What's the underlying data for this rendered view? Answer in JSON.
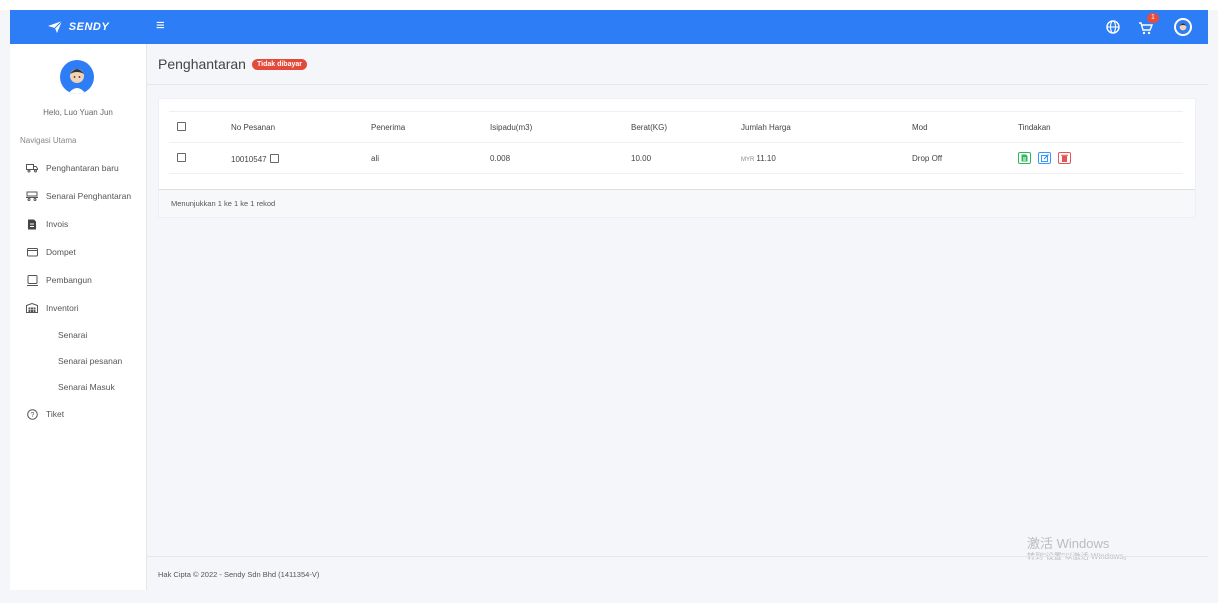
{
  "app": {
    "brand": "SENDY",
    "cart_count": "1",
    "accent_color": "#2d7df6"
  },
  "sidebar": {
    "greeting": "Helo, Luo Yuan Jun",
    "nav_heading": "Navigasi Utama",
    "items": [
      {
        "label": "Penghantaran baru",
        "icon": "truck-icon"
      },
      {
        "label": "Senarai Penghantaran",
        "icon": "list-truck-icon"
      },
      {
        "label": "Invois",
        "icon": "invoice-icon"
      },
      {
        "label": "Dompet",
        "icon": "wallet-icon"
      },
      {
        "label": "Pembangun",
        "icon": "developer-icon"
      },
      {
        "label": "Inventori",
        "icon": "warehouse-icon"
      }
    ],
    "sub_items": [
      "Senarai",
      "Senarai pesanan",
      "Senarai Masuk"
    ],
    "ticket": {
      "label": "Tiket",
      "icon": "help-icon"
    }
  },
  "page": {
    "title": "Penghantaran",
    "status_badge": "Tidak dibayar"
  },
  "table": {
    "headers": [
      "No Pesanan",
      "Penerima",
      "Isipadu(m3)",
      "Berat(KG)",
      "Jumlah Harga",
      "Mod",
      "Tindakan"
    ],
    "rows": [
      {
        "order_no": "10010547",
        "recipient": "ali",
        "volume": "0.008",
        "weight": "10.00",
        "currency": "MYR",
        "price": "11.10",
        "mode": "Drop Off"
      }
    ],
    "footer": "Menunjukkan 1 ke 1 ke 1 rekod"
  },
  "footer": {
    "copyright": "Hak Cipta © 2022 - Sendy Sdn Bhd (1411354-V)"
  },
  "watermark": {
    "line1": "激活 Windows",
    "line2": "转到\"设置\"以激活 Windows。"
  }
}
